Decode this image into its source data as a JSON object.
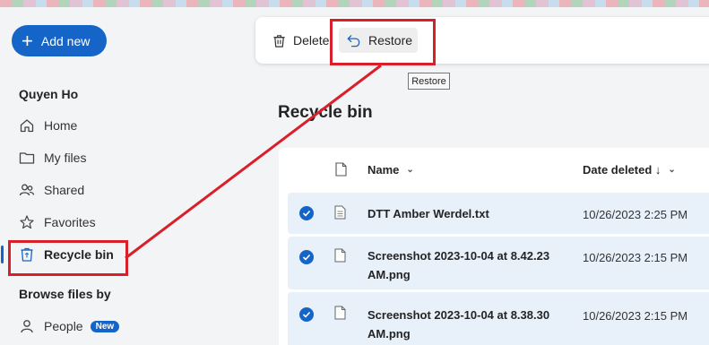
{
  "header": {
    "add_new_label": "Add new",
    "user_name": "Quyen Ho"
  },
  "sidebar": {
    "items": [
      {
        "label": "Home",
        "icon": "home-icon"
      },
      {
        "label": "My files",
        "icon": "folder-icon"
      },
      {
        "label": "Shared",
        "icon": "shared-icon"
      },
      {
        "label": "Favorites",
        "icon": "star-icon"
      },
      {
        "label": "Recycle bin",
        "icon": "recycle-bin-icon",
        "active": true
      }
    ],
    "browse_title": "Browse files by",
    "browse_items": [
      {
        "label": "People",
        "badge": "New",
        "icon": "person-icon"
      }
    ]
  },
  "toolbar": {
    "delete_label": "Delete",
    "restore_label": "Restore",
    "tooltip": "Restore"
  },
  "main": {
    "title": "Recycle bin",
    "columns": {
      "name": "Name",
      "date_deleted": "Date deleted ↓"
    },
    "rows": [
      {
        "name": "DTT Amber Werdel.txt",
        "date": "10/26/2023 2:25 PM",
        "selected": true
      },
      {
        "name": "Screenshot 2023-10-04 at 8.42.23 AM.png",
        "date": "10/26/2023 2:15 PM",
        "selected": true
      },
      {
        "name": "Screenshot 2023-10-04 at 8.38.30 AM.png",
        "date": "10/26/2023 2:15 PM",
        "selected": true
      }
    ]
  },
  "colors": {
    "accent": "#1565c8",
    "annotation": "#d9202a",
    "selected_row": "#e8f0fa"
  }
}
